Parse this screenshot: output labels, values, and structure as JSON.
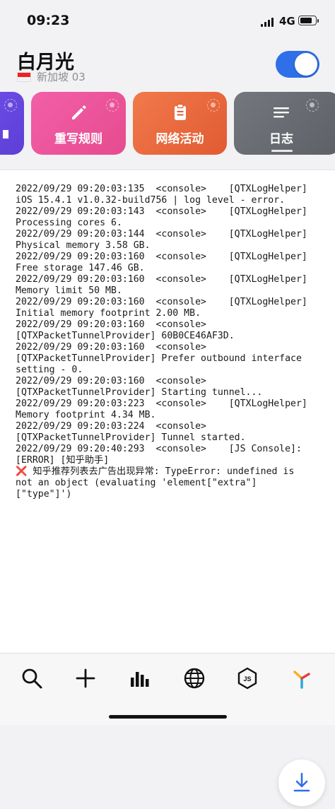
{
  "status_bar": {
    "time": "09:23",
    "network": "4G"
  },
  "header": {
    "title": "白月光",
    "subtitle": "新加坡 03",
    "vpn_enabled": true
  },
  "cards": [
    {
      "label": "",
      "icon": "partial-card-icon",
      "color": "#6c4ee6"
    },
    {
      "label": "重写规则",
      "icon": "pencil-icon",
      "color": "#ec5599"
    },
    {
      "label": "网络活动",
      "icon": "clipboard-icon",
      "color": "#e96a3f"
    },
    {
      "label": "日志",
      "icon": "list-lines-icon",
      "color": "#686b72"
    }
  ],
  "log": {
    "lines": [
      "2022/09/29 09:20:03:135  <console>    [QTXLogHelper]",
      "iOS 15.4.1 v1.0.32-build756 | log level - error.",
      "2022/09/29 09:20:03:143  <console>    [QTXLogHelper]",
      "Processing cores 6.",
      "2022/09/29 09:20:03:144  <console>    [QTXLogHelper]",
      "Physical memory 3.58 GB.",
      "2022/09/29 09:20:03:160  <console>    [QTXLogHelper]",
      "Free storage 147.46 GB.",
      "2022/09/29 09:20:03:160  <console>    [QTXLogHelper]",
      "Memory limit 50 MB.",
      "2022/09/29 09:20:03:160  <console>    [QTXLogHelper]",
      "Initial memory footprint 2.00 MB.",
      "2022/09/29 09:20:03:160  <console>",
      "[QTXPacketTunnelProvider] 60B0CE46AF3D.",
      "2022/09/29 09:20:03:160  <console>",
      "[QTXPacketTunnelProvider] Prefer outbound interface",
      "setting - 0.",
      "2022/09/29 09:20:03:160  <console>",
      "[QTXPacketTunnelProvider] Starting tunnel...",
      "2022/09/29 09:20:03:223  <console>    [QTXLogHelper]",
      "Memory footprint 4.34 MB.",
      "2022/09/29 09:20:03:224  <console>",
      "[QTXPacketTunnelProvider] Tunnel started.",
      "2022/09/29 09:20:40:293  <console>    [JS Console]:",
      "[ERROR] [知乎助手]"
    ],
    "error_mark": "❌",
    "error_lines": [
      " 知乎推荐列表去广告出现异常: TypeError: undefined is",
      "not an object (evaluating 'element[\"extra\"]",
      "[\"type\"]')"
    ]
  },
  "tabs": [
    {
      "name": "search",
      "icon": "search-icon"
    },
    {
      "name": "add",
      "icon": "plus-icon"
    },
    {
      "name": "statistics",
      "icon": "bar-chart-icon"
    },
    {
      "name": "network",
      "icon": "globe-icon"
    },
    {
      "name": "scripts",
      "icon": "js-icon",
      "label": "JS"
    },
    {
      "name": "app",
      "icon": "app-logo-icon"
    }
  ],
  "colors": {
    "accent": "#2f6fe8",
    "error": "#e0262c",
    "toggle_on": "#2f6fe8"
  }
}
